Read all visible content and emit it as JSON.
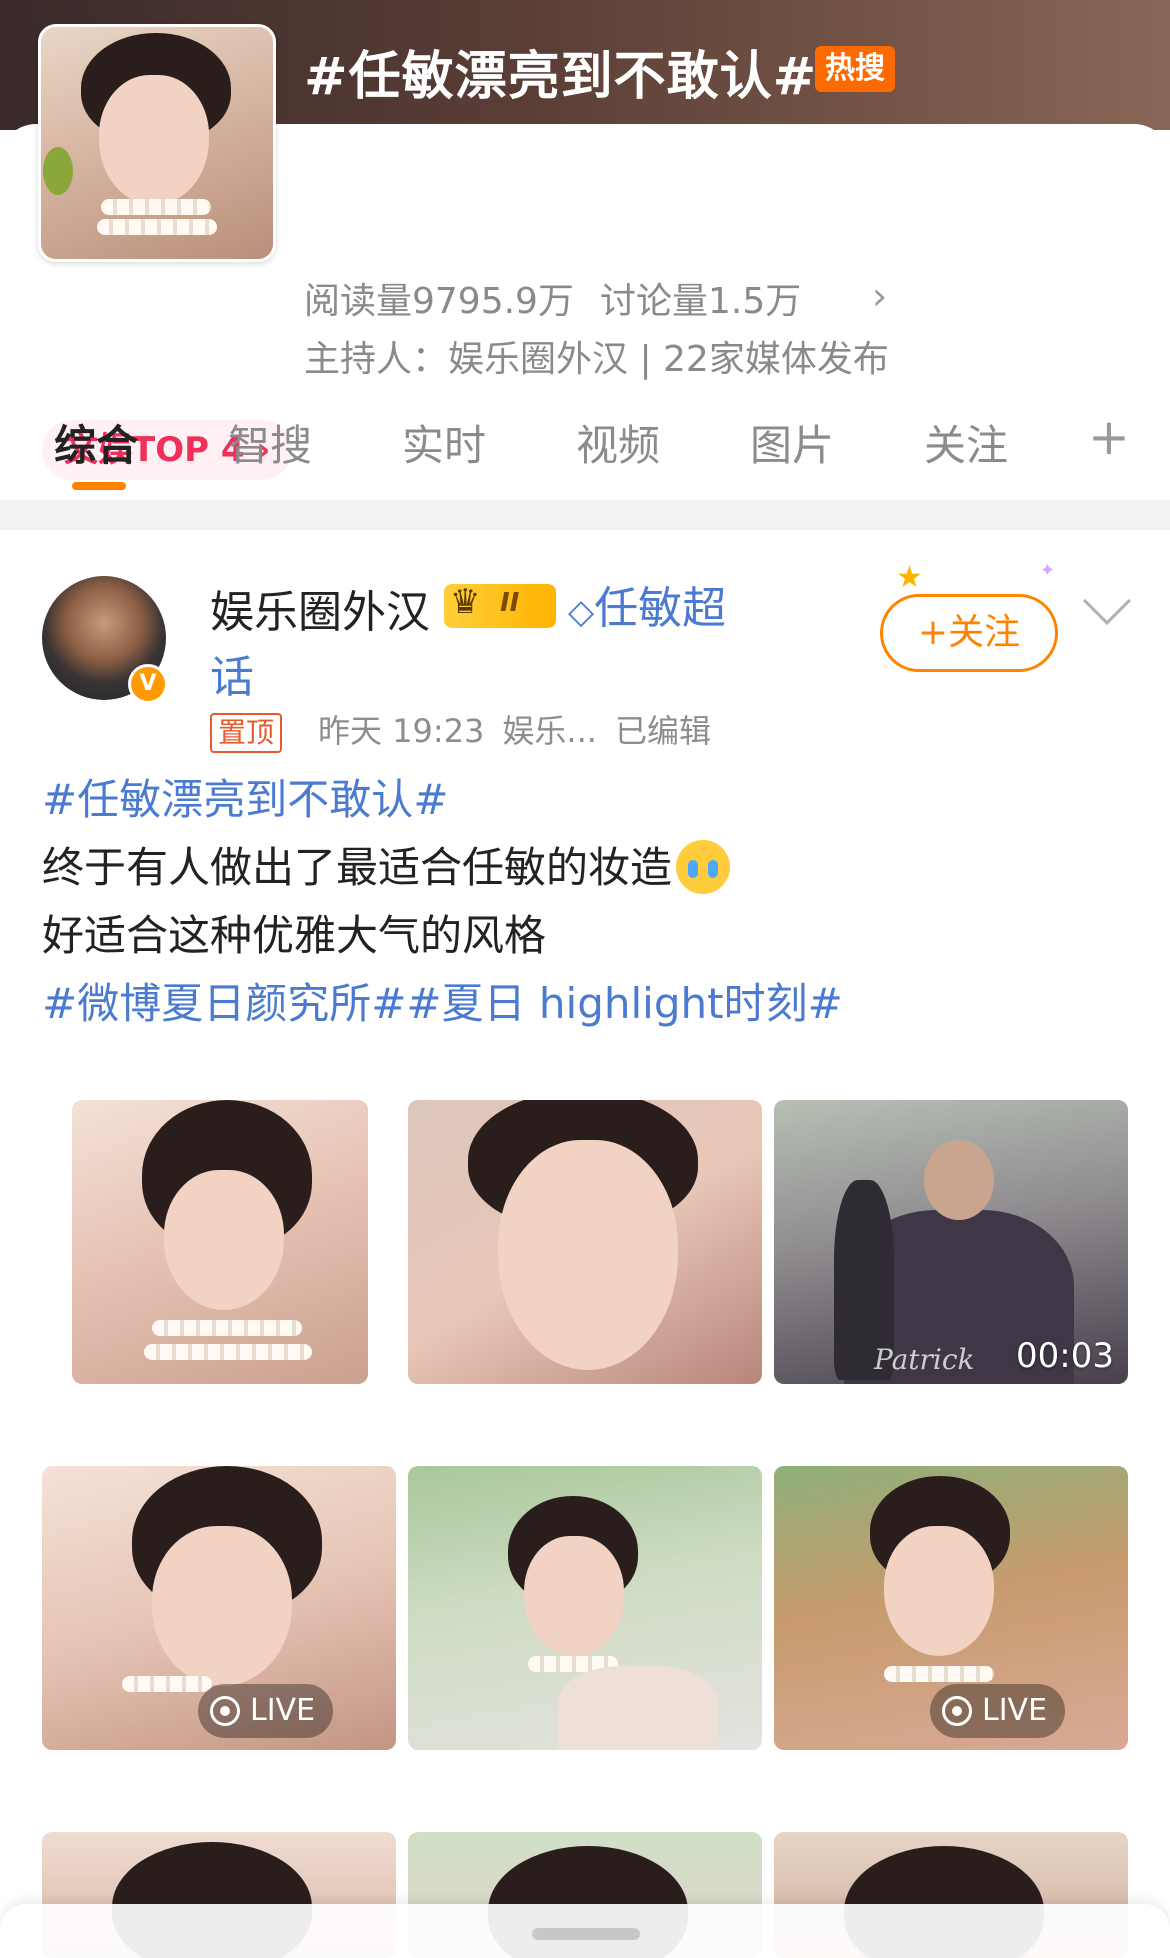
{
  "topic": {
    "title": "#任敏漂亮到不敢认#",
    "hot_badge": "热搜",
    "reads": "阅读量9795.9万",
    "discussions": "讨论量1.5万",
    "host_line": "主持人：娱乐圈外汉 | 22家媒体发布",
    "rank_badge": "文娱TOP 4 ›"
  },
  "tabs": [
    "综合",
    "智搜",
    "实时",
    "视频",
    "图片",
    "关注"
  ],
  "tab_plus": "+",
  "post": {
    "username": "娱乐圈外汉",
    "vip_level": "II",
    "super_topic_line1": "任敏超",
    "super_topic_line2": "话",
    "pin_label": "置顶",
    "time": "昨天 19:23",
    "source": "娱乐...",
    "edited": "已编辑",
    "follow_label": "+关注",
    "text": {
      "hashtag1": "#任敏漂亮到不敢认#",
      "line1": "终于有人做出了最适合任敏的妆造",
      "line2": "好适合这种优雅大气的风格",
      "hashtag2": "#微博夏日颜究所##夏日 highlight时刻#"
    },
    "photos": {
      "video_duration": "00:03",
      "video_watermark": "Patrick",
      "live_label": "LIVE"
    }
  },
  "colors": {
    "accent": "#ff8200",
    "link": "#4b7bd0",
    "hot": "#ff6a00",
    "rank": "#f0305a"
  }
}
